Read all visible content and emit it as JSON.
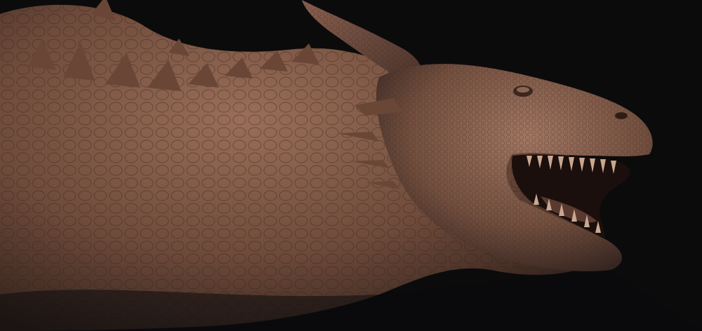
{
  "scene": {
    "subject": "dragon-sculpt",
    "background_color": "#0b0b0c",
    "material_color": "#7a5442",
    "material_shadow": "#3e2a22",
    "material_highlight": "#a57a63",
    "mouth_color": "#1a0f0c",
    "teeth_color": "#caa890"
  }
}
